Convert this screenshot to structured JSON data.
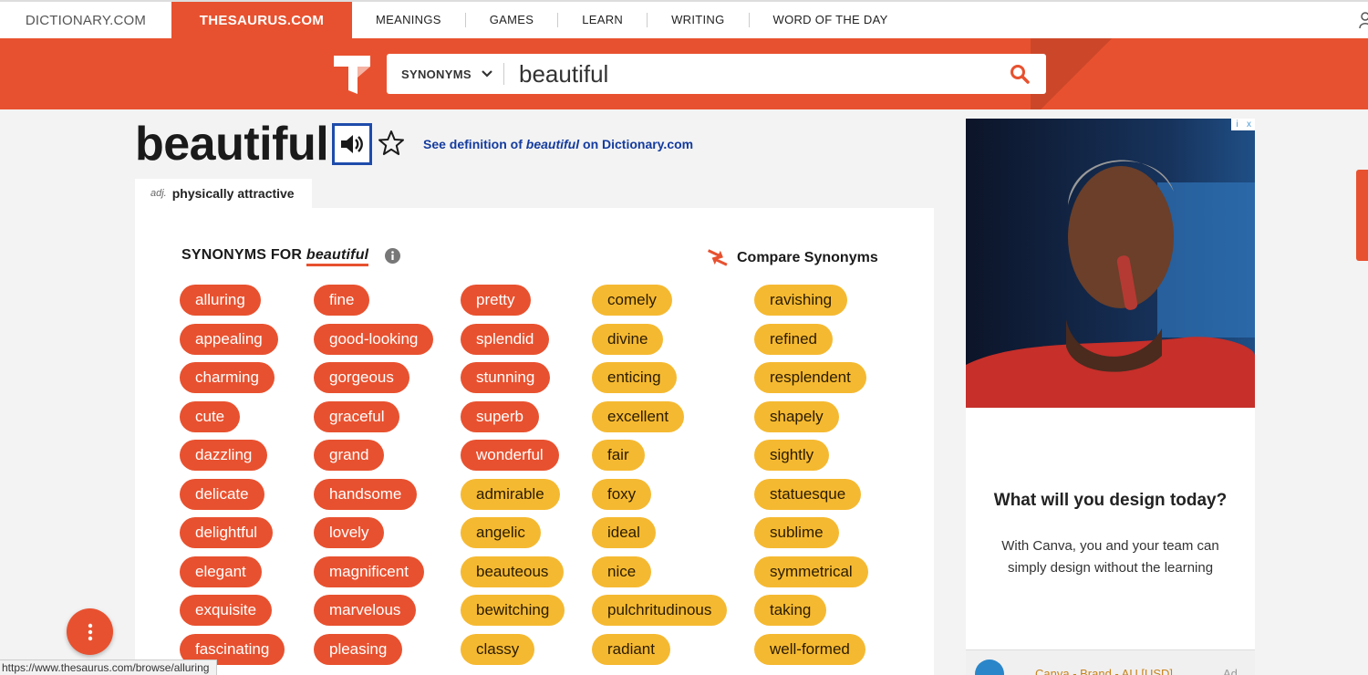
{
  "topnav": {
    "dictionary": "DICTIONARY.COM",
    "thesaurus": "THESAURUS.COM",
    "links": [
      "MEANINGS",
      "GAMES",
      "LEARN",
      "WRITING",
      "WORD OF THE DAY"
    ]
  },
  "search": {
    "type_label": "SYNONYMS",
    "query": "beautiful"
  },
  "entry": {
    "word": "beautiful",
    "see_def_prefix": "See definition of ",
    "see_def_word": "beautiful",
    "see_def_suffix": " on Dictionary.com",
    "def_pos": "adj.",
    "def_text": "physically attractive"
  },
  "synonyms": {
    "heading_prefix": "SYNONYMS FOR ",
    "heading_word": "beautiful",
    "compare_label": "Compare Synonyms",
    "columns": [
      [
        {
          "word": "alluring",
          "tier": "red"
        },
        {
          "word": "appealing",
          "tier": "red"
        },
        {
          "word": "charming",
          "tier": "red"
        },
        {
          "word": "cute",
          "tier": "red"
        },
        {
          "word": "dazzling",
          "tier": "red"
        },
        {
          "word": "delicate",
          "tier": "red"
        },
        {
          "word": "delightful",
          "tier": "red"
        },
        {
          "word": "elegant",
          "tier": "red"
        },
        {
          "word": "exquisite",
          "tier": "red"
        },
        {
          "word": "fascinating",
          "tier": "red"
        }
      ],
      [
        {
          "word": "fine",
          "tier": "red"
        },
        {
          "word": "good-looking",
          "tier": "red"
        },
        {
          "word": "gorgeous",
          "tier": "red"
        },
        {
          "word": "graceful",
          "tier": "red"
        },
        {
          "word": "grand",
          "tier": "red"
        },
        {
          "word": "handsome",
          "tier": "red"
        },
        {
          "word": "lovely",
          "tier": "red"
        },
        {
          "word": "magnificent",
          "tier": "red"
        },
        {
          "word": "marvelous",
          "tier": "red"
        },
        {
          "word": "pleasing",
          "tier": "red"
        }
      ],
      [
        {
          "word": "pretty",
          "tier": "red"
        },
        {
          "word": "splendid",
          "tier": "red"
        },
        {
          "word": "stunning",
          "tier": "red"
        },
        {
          "word": "superb",
          "tier": "red"
        },
        {
          "word": "wonderful",
          "tier": "red"
        },
        {
          "word": "admirable",
          "tier": "yellow"
        },
        {
          "word": "angelic",
          "tier": "yellow"
        },
        {
          "word": "beauteous",
          "tier": "yellow"
        },
        {
          "word": "bewitching",
          "tier": "yellow"
        },
        {
          "word": "classy",
          "tier": "yellow"
        }
      ],
      [
        {
          "word": "comely",
          "tier": "yellow"
        },
        {
          "word": "divine",
          "tier": "yellow"
        },
        {
          "word": "enticing",
          "tier": "yellow"
        },
        {
          "word": "excellent",
          "tier": "yellow"
        },
        {
          "word": "fair",
          "tier": "yellow"
        },
        {
          "word": "foxy",
          "tier": "yellow"
        },
        {
          "word": "ideal",
          "tier": "yellow"
        },
        {
          "word": "nice",
          "tier": "yellow"
        },
        {
          "word": "pulchritudinous",
          "tier": "yellow"
        },
        {
          "word": "radiant",
          "tier": "yellow"
        }
      ],
      [
        {
          "word": "ravishing",
          "tier": "yellow"
        },
        {
          "word": "refined",
          "tier": "yellow"
        },
        {
          "word": "resplendent",
          "tier": "yellow"
        },
        {
          "word": "shapely",
          "tier": "yellow"
        },
        {
          "word": "sightly",
          "tier": "yellow"
        },
        {
          "word": "statuesque",
          "tier": "yellow"
        },
        {
          "word": "sublime",
          "tier": "yellow"
        },
        {
          "word": "symmetrical",
          "tier": "yellow"
        },
        {
          "word": "taking",
          "tier": "yellow"
        },
        {
          "word": "well-formed",
          "tier": "yellow"
        }
      ]
    ]
  },
  "ad": {
    "headline": "What will you design today?",
    "body": "With Canva, you and your team can simply design without the learning",
    "brand": "Canva - Brand - AU [USD]",
    "label": "Ad",
    "badge_info": "i",
    "badge_close": "x"
  },
  "statusbar": {
    "url": "https://www.thesaurus.com/browse/alluring"
  },
  "colors": {
    "brand_orange": "#e8512f",
    "strong_synonym": "#e8512f",
    "weak_synonym": "#f5b931",
    "link_blue": "#143b9e"
  },
  "icons": [
    "thesaurus-logo-icon",
    "chevron-down-icon",
    "search-icon",
    "speaker-icon",
    "star-icon",
    "info-icon",
    "compare-arrows-icon",
    "user-icon",
    "kebab-menu-icon"
  ]
}
